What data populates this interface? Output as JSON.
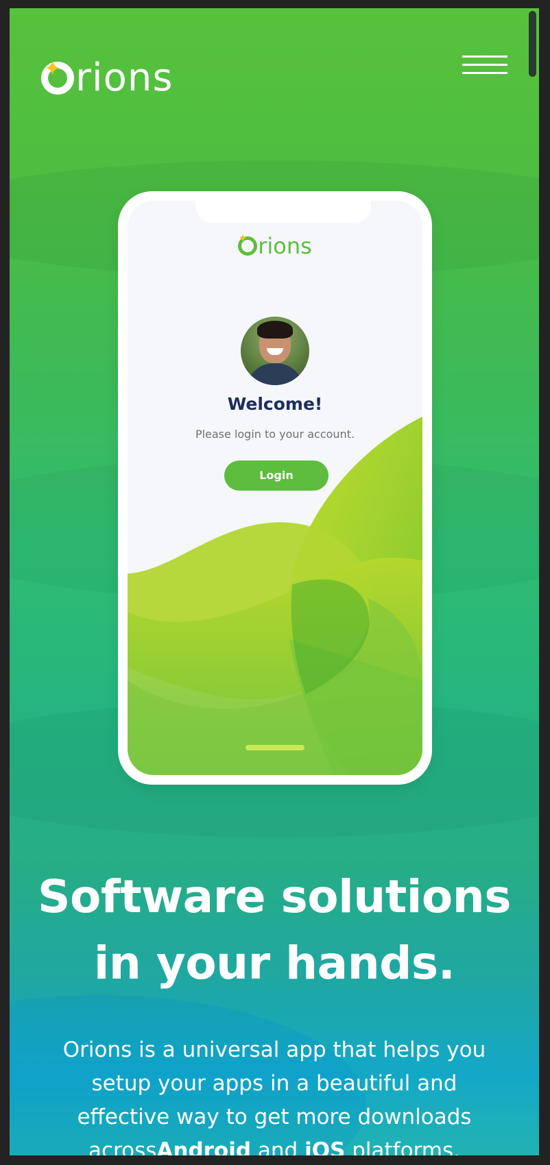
{
  "header": {
    "logo_text": "rions",
    "logo_icon": "orions-logo-icon",
    "menu_icon": "hamburger-menu-icon"
  },
  "phone": {
    "logo_text": "rions",
    "welcome": "Welcome!",
    "subtitle": "Please login to your account.",
    "login_label": "Login"
  },
  "hero": {
    "headline_line1": "Software solutions",
    "headline_line2": "in your hands.",
    "description_part1": "Orions is a universal app that helps you setup your apps in a beautiful and effective way to get more downloads across",
    "description_bold1": "Android",
    "description_part2": " and ",
    "description_bold2": "iOS",
    "description_part3": " platforms."
  },
  "colors": {
    "brand_green": "#5cbd3e",
    "accent_yellow": "#f7c51e",
    "navy": "#1d2e5b"
  }
}
